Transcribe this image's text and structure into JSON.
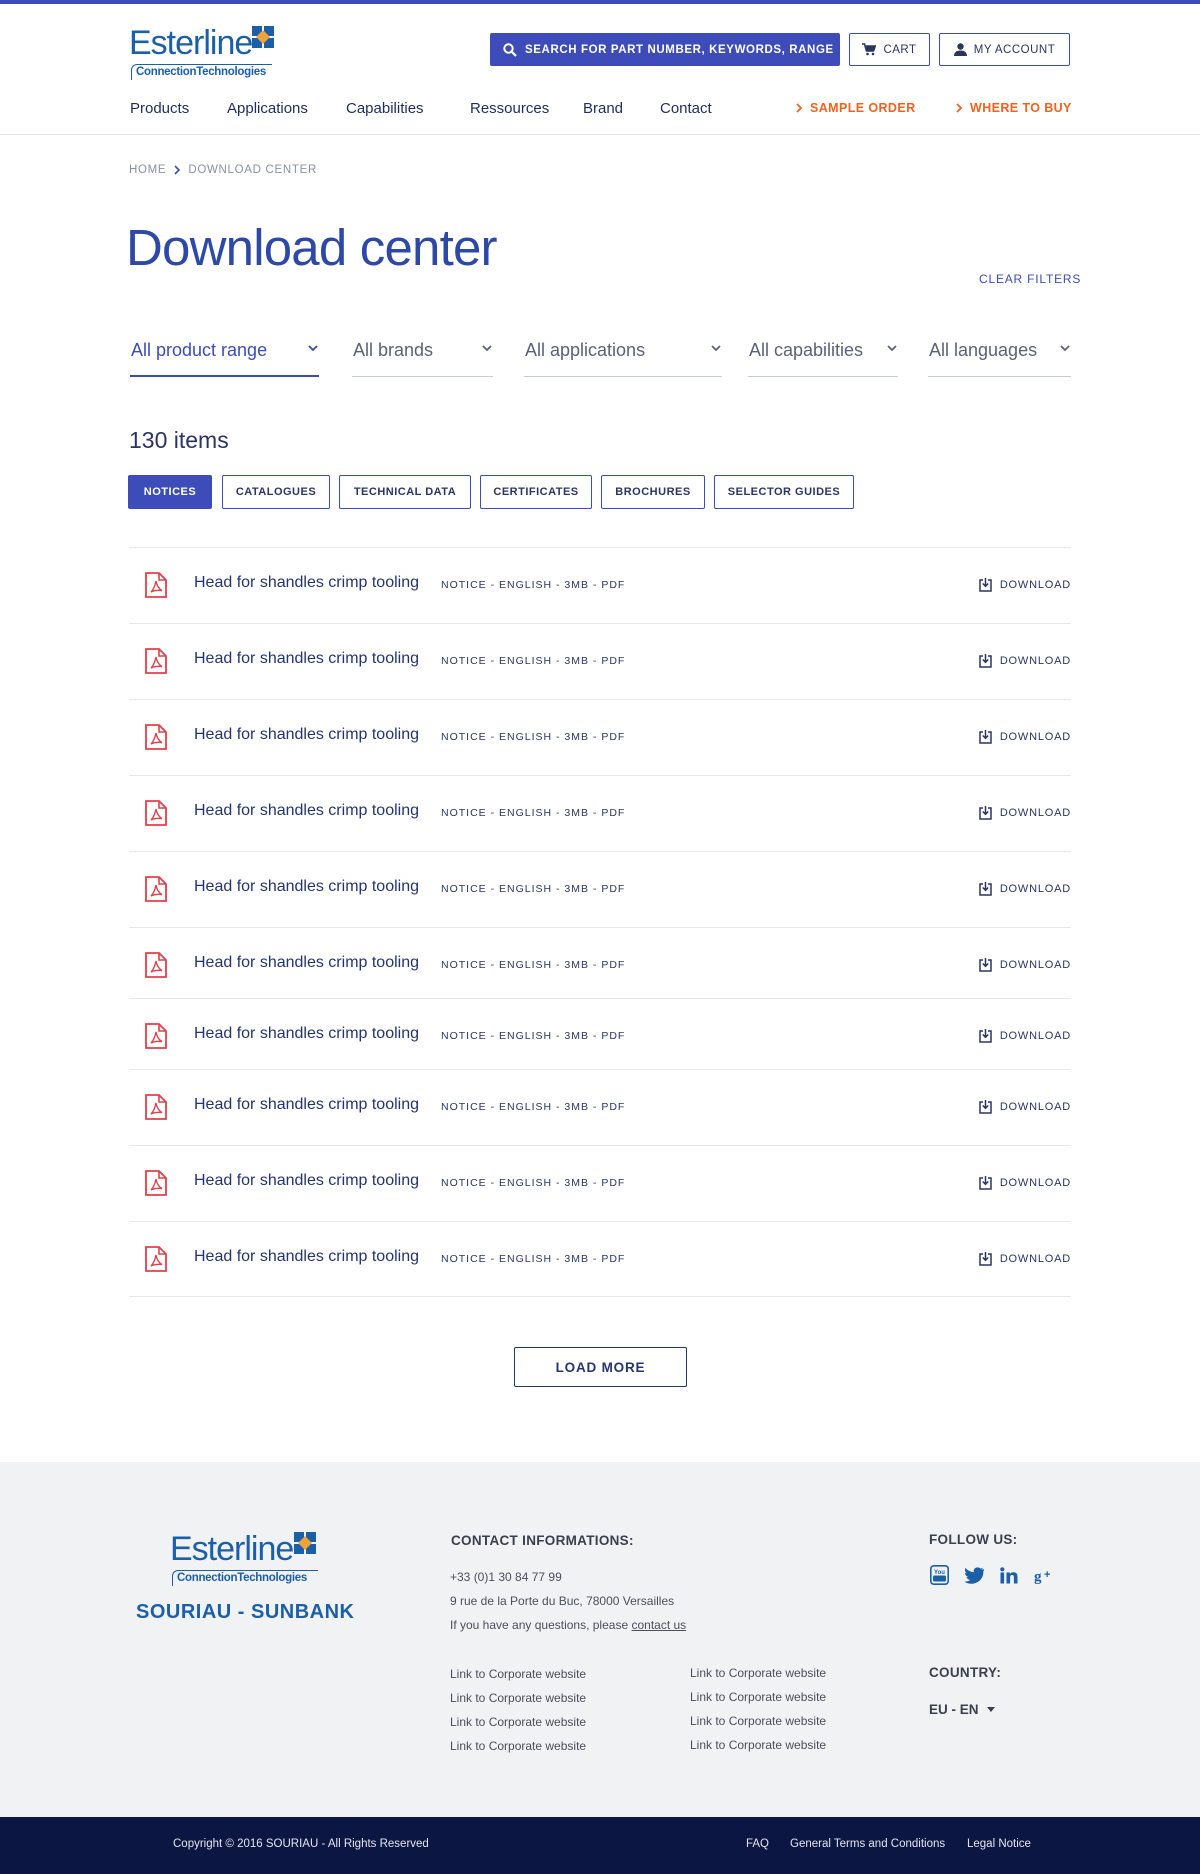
{
  "header": {
    "logo_word": "Esterline",
    "logo_sub": "ConnectionTechnologies",
    "search_label": "SEARCH FOR PART NUMBER, KEYWORDS, RANGE",
    "cart_label": "CART",
    "account_label": "MY ACCOUNT",
    "nav": [
      "Products",
      "Applications",
      "Capabilities",
      "Ressources",
      "Brand",
      "Contact"
    ],
    "sample_order": "SAMPLE ORDER",
    "where_to_buy": "WHERE TO BUY",
    "accent_color": "#3d4cb8",
    "orange_color": "#f0631e"
  },
  "breadcrumb": {
    "home": "HOME",
    "current": "DOWNLOAD CENTER"
  },
  "page": {
    "title": "Download center",
    "clear_filters": "CLEAR FILTERS",
    "filters": [
      "All product range",
      "All brands",
      "All applications",
      "All capabilities",
      "All languages"
    ],
    "count": "130 items",
    "chips": [
      "NOTICES",
      "CATALOGUES",
      "TECHNICAL DATA",
      "CERTIFICATES",
      "BROCHURES",
      "SELECTOR GUIDES"
    ],
    "active_chip": "NOTICES",
    "load_more": "LOAD MORE"
  },
  "documents": [
    {
      "title": "Head for shandles crimp tooling",
      "meta": "NOTICE - ENGLISH - 3MB - PDF",
      "action": "DOWNLOAD",
      "icon": "pdf-icon"
    },
    {
      "title": "Head for shandles crimp tooling",
      "meta": "NOTICE - ENGLISH - 3MB - PDF",
      "action": "DOWNLOAD",
      "icon": "pdf-icon"
    },
    {
      "title": "Head for shandles crimp tooling",
      "meta": "NOTICE - ENGLISH - 3MB - PDF",
      "action": "DOWNLOAD",
      "icon": "pdf-icon"
    },
    {
      "title": "Head for shandles crimp tooling",
      "meta": "NOTICE - ENGLISH - 3MB - PDF",
      "action": "DOWNLOAD",
      "icon": "pdf-icon"
    },
    {
      "title": "Head for shandles crimp tooling",
      "meta": "NOTICE - ENGLISH - 3MB - PDF",
      "action": "DOWNLOAD",
      "icon": "pdf-icon"
    },
    {
      "title": "Head for shandles crimp tooling",
      "meta": "NOTICE - ENGLISH - 3MB - PDF",
      "action": "DOWNLOAD",
      "icon": "pdf-icon"
    },
    {
      "title": "Head for shandles crimp tooling",
      "meta": "NOTICE - ENGLISH - 3MB - PDF",
      "action": "DOWNLOAD",
      "icon": "pdf-icon"
    },
    {
      "title": "Head for shandles crimp tooling",
      "meta": "NOTICE - ENGLISH - 3MB - PDF",
      "action": "DOWNLOAD",
      "icon": "pdf-icon"
    },
    {
      "title": "Head for shandles crimp tooling",
      "meta": "NOTICE - ENGLISH - 3MB - PDF",
      "action": "DOWNLOAD",
      "icon": "pdf-icon"
    },
    {
      "title": "Head for shandles crimp tooling",
      "meta": "NOTICE - ENGLISH - 3MB - PDF",
      "action": "DOWNLOAD",
      "icon": "pdf-icon"
    }
  ],
  "footer": {
    "brand": "SOURIAU - SUNBANK",
    "contact_heading": "CONTACT INFORMATIONS:",
    "phone": "+33 (0)1 30 84 77 99",
    "address": "9 rue de la Porte du Buc, 78000 Versailles",
    "question_text": "If you have any questions, please",
    "contact_link": "contact us",
    "links_col1": [
      "Link to Corporate website",
      "Link to Corporate website",
      "Link to Corporate website",
      "Link to Corporate website"
    ],
    "links_col2": [
      "Link to Corporate website",
      "Link to Corporate website",
      "Link to Corporate website",
      "Link to Corporate website"
    ],
    "follow_heading": "FOLLOW US:",
    "social": [
      "youtube-icon",
      "twitter-icon",
      "linkedin-icon",
      "google-plus-icon"
    ],
    "country_heading": "COUNTRY:",
    "country_value": "EU - EN",
    "copyright": "Copyright © 2016 SOURIAU - All Rights Reserved",
    "bottom_links": [
      "FAQ",
      "General Terms and Conditions",
      "Legal Notice"
    ]
  }
}
